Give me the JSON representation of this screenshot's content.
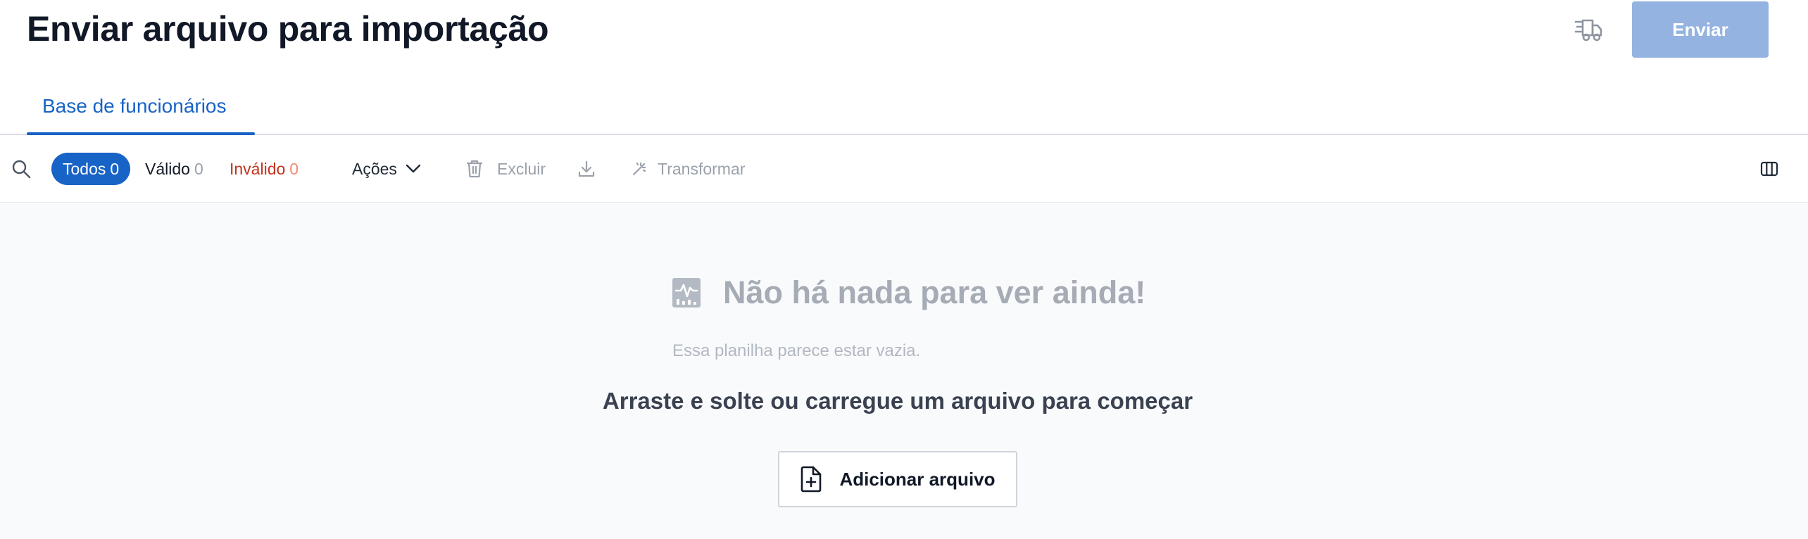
{
  "header": {
    "title": "Enviar arquivo para importação",
    "send_label": "Enviar",
    "truck_icon": "truck-list-icon"
  },
  "tabs": [
    {
      "label": "Base de funcionários",
      "active": true
    }
  ],
  "toolbar": {
    "search_icon": "search-icon",
    "filters": {
      "all_label": "Todos",
      "all_count": "0",
      "valid_label": "Válido",
      "valid_count": "0",
      "invalid_label": "Inválido",
      "invalid_count": "0"
    },
    "actions_label": "Ações",
    "delete_label": "Excluir",
    "download_icon": "download-icon",
    "transform_label": "Transformar",
    "columns_icon": "columns-icon"
  },
  "empty_state": {
    "title": "Não há nada para ver ainda!",
    "subtitle": "Essa planilha parece estar vazia.",
    "drop_text": "Arraste e solte ou carregue um arquivo para começar",
    "add_file_label": "Adicionar arquivo"
  },
  "colors": {
    "accent": "#1863c6",
    "send_disabled": "#95b3e0",
    "invalid": "#c4321d",
    "muted": "#9aa1ab",
    "empty_bg": "#f9fafc"
  }
}
